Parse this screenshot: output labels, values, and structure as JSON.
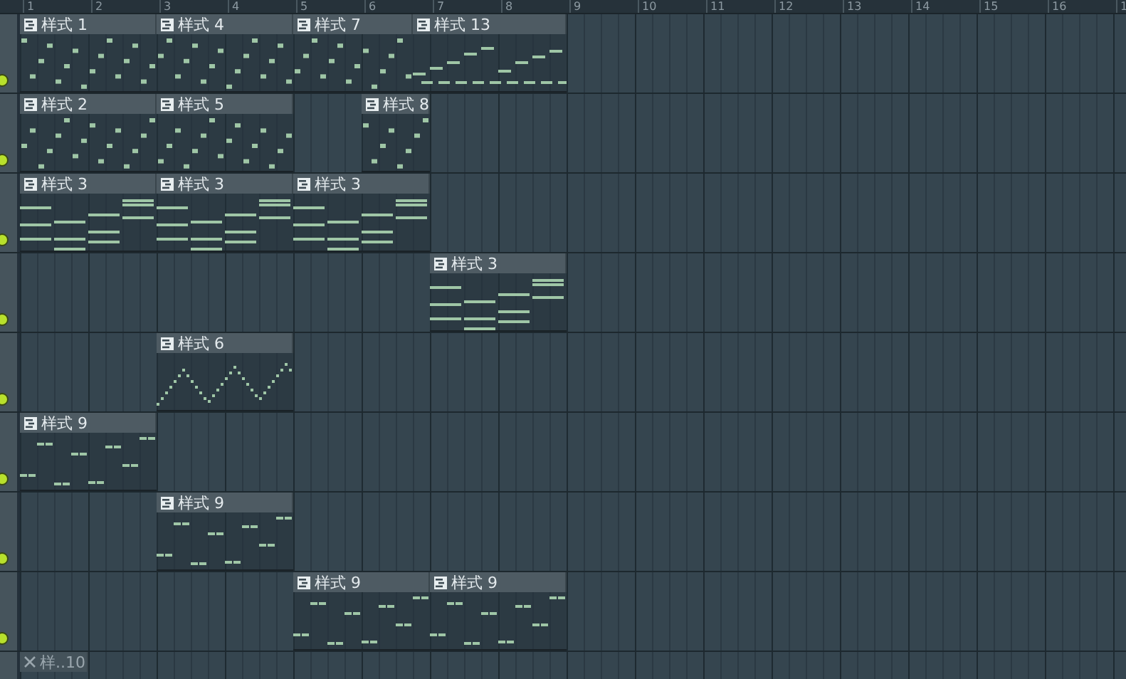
{
  "ruler": {
    "bars": [
      "1",
      "2",
      "3",
      "4",
      "5",
      "6",
      "7",
      "8",
      "9",
      "10",
      "11",
      "12",
      "13",
      "14",
      "15",
      "16",
      "1"
    ]
  },
  "tracks": [
    {
      "clips": [
        {
          "label": "样式 1",
          "kind": "melody"
        },
        {
          "label": "样式 4",
          "kind": "melody"
        },
        {
          "label": "样式 7",
          "kind": "melody"
        },
        {
          "label": "样式 13",
          "kind": "steps"
        }
      ]
    },
    {
      "clips": [
        {
          "label": "样式 2",
          "kind": "melody"
        },
        {
          "label": "样式 5",
          "kind": "melody"
        },
        {
          "label": "样式 8",
          "kind": "melody"
        }
      ]
    },
    {
      "clips": [
        {
          "label": "样式 3",
          "kind": "chords"
        },
        {
          "label": "样式 3",
          "kind": "chords"
        },
        {
          "label": "样式 3",
          "kind": "chords"
        }
      ]
    },
    {
      "clips": [
        {
          "label": "样式 3",
          "kind": "chords"
        }
      ]
    },
    {
      "clips": [
        {
          "label": "样式 6",
          "kind": "arp"
        }
      ]
    },
    {
      "clips": [
        {
          "label": "样式 9",
          "kind": "bass"
        }
      ]
    },
    {
      "clips": [
        {
          "label": "样式 9",
          "kind": "bass"
        }
      ]
    },
    {
      "clips": [
        {
          "label": "样式 9",
          "kind": "bass"
        },
        {
          "label": "样式 9",
          "kind": "bass"
        }
      ]
    },
    {
      "clips": [
        {
          "label": "样..10",
          "kind": "muted"
        }
      ]
    }
  ]
}
